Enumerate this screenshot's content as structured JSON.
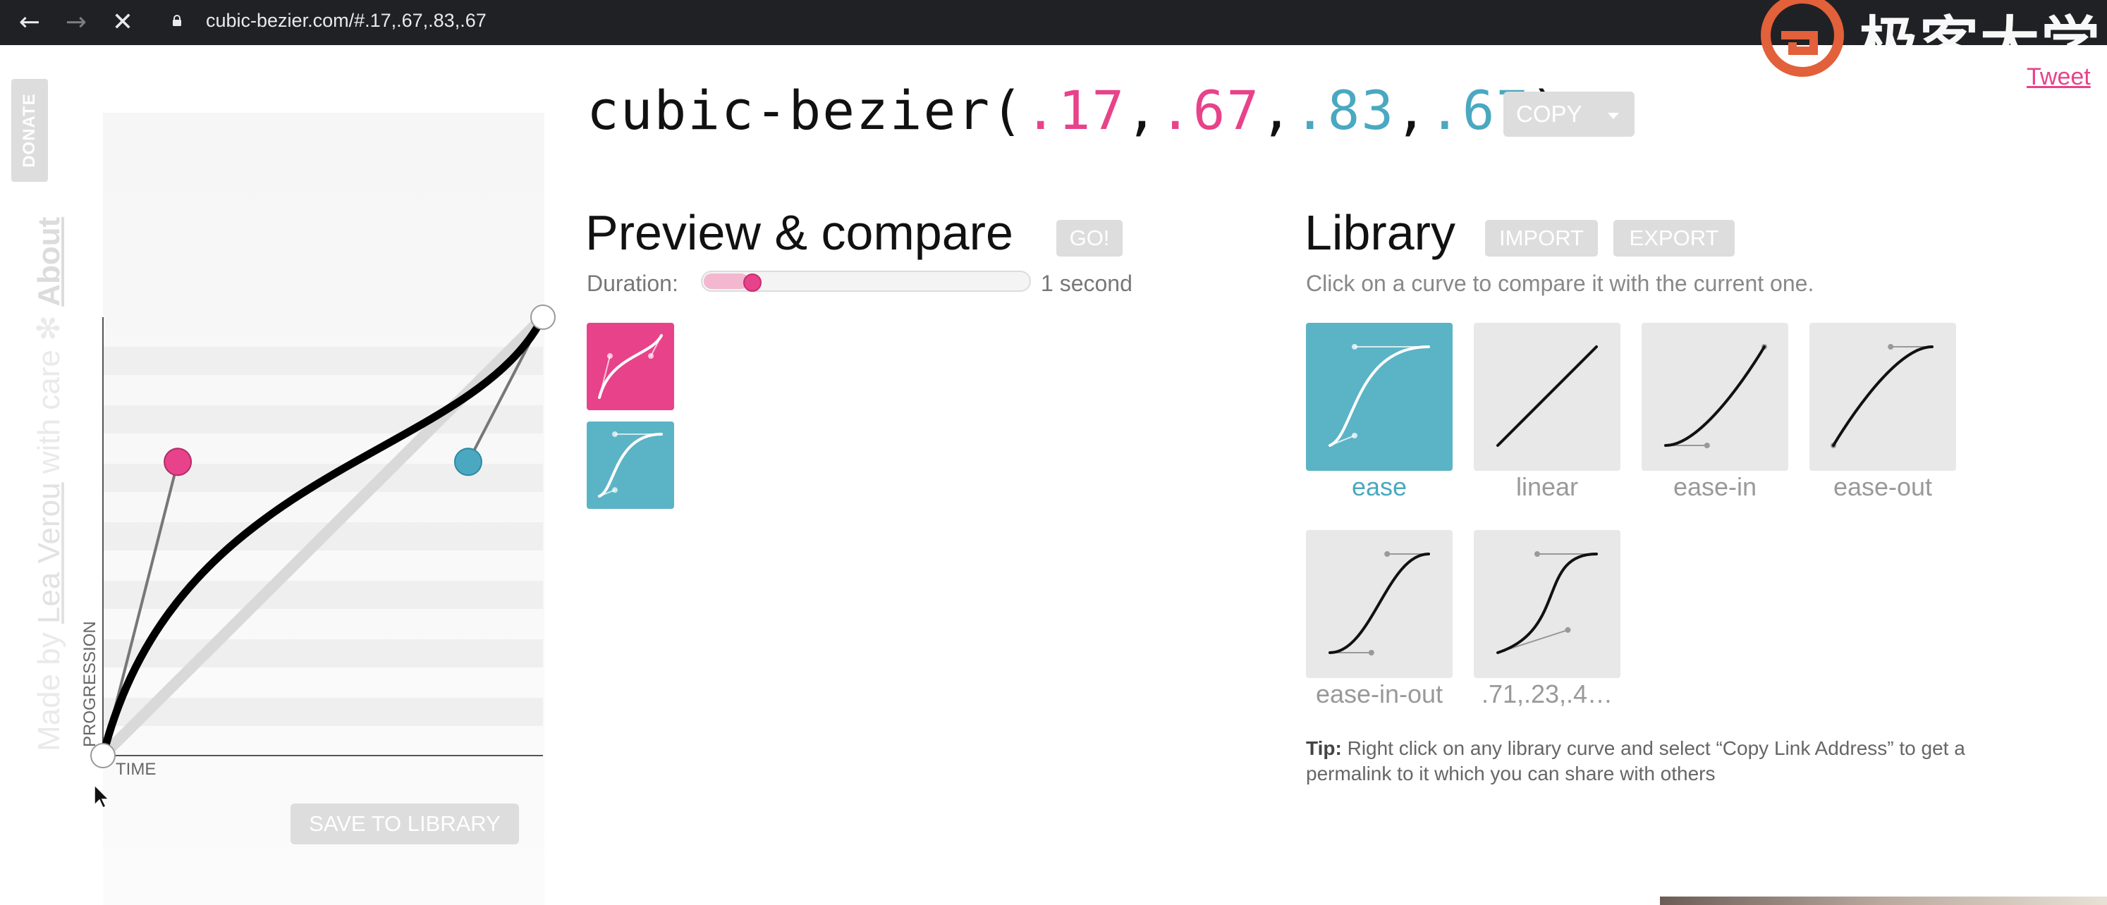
{
  "browser": {
    "url": "cubic-bezier.com/#.17,.67,.83,.67",
    "back_icon": "arrow-left-icon",
    "forward_icon": "arrow-right-icon",
    "stop_icon": "close-icon"
  },
  "watermark": {
    "text": "极客大学"
  },
  "header": {
    "tweet": "Tweet",
    "title_prefix": "cubic-bezier(",
    "p1x": ".17",
    "p1y": ".67",
    "p2x": ".83",
    "p2y": ".67",
    "sep": ",",
    "title_suffix": ")",
    "copy_label": "COPY"
  },
  "sidebar": {
    "donate": "DONATE",
    "made_by": "Made by ",
    "author": "Lea Verou",
    "with_care": " with care ✻ ",
    "about": "About"
  },
  "graph": {
    "progression_label": "PROGRESSION",
    "time_label": "TIME",
    "save_label": "SAVE TO LIBRARY",
    "curve": [
      0.17,
      0.67,
      0.83,
      0.67
    ],
    "colors": {
      "p1": "#e8428a",
      "p2": "#4aa8c0"
    }
  },
  "preview": {
    "title": "Preview & compare",
    "go_label": "GO!",
    "duration_label": "Duration:",
    "duration_value": "1 second",
    "duration_fraction": 0.06
  },
  "library": {
    "title": "Library",
    "import_label": "IMPORT",
    "export_label": "EXPORT",
    "description": "Click on a curve to compare it with the current one.",
    "items": [
      {
        "label": "ease",
        "bezier": [
          0.25,
          0.1,
          0.25,
          1
        ],
        "selected": true
      },
      {
        "label": "linear",
        "bezier": [
          0,
          0,
          1,
          1
        ],
        "selected": false
      },
      {
        "label": "ease-in",
        "bezier": [
          0.42,
          0,
          1,
          1
        ],
        "selected": false
      },
      {
        "label": "ease-out",
        "bezier": [
          0,
          0,
          0.58,
          1
        ],
        "selected": false
      },
      {
        "label": "ease-in-out",
        "bezier": [
          0.42,
          0,
          0.58,
          1
        ],
        "selected": false
      },
      {
        "label": ".71,.23,.4…",
        "bezier": [
          0.71,
          0.23,
          0.4,
          1
        ],
        "selected": false
      }
    ],
    "tip_bold": "Tip:",
    "tip_text": " Right click on any library curve and select “Copy Link Address” to get a permalink to it which you can share with others"
  },
  "colors": {
    "accent_pink": "#e8428a",
    "accent_teal": "#4aa8c0"
  }
}
